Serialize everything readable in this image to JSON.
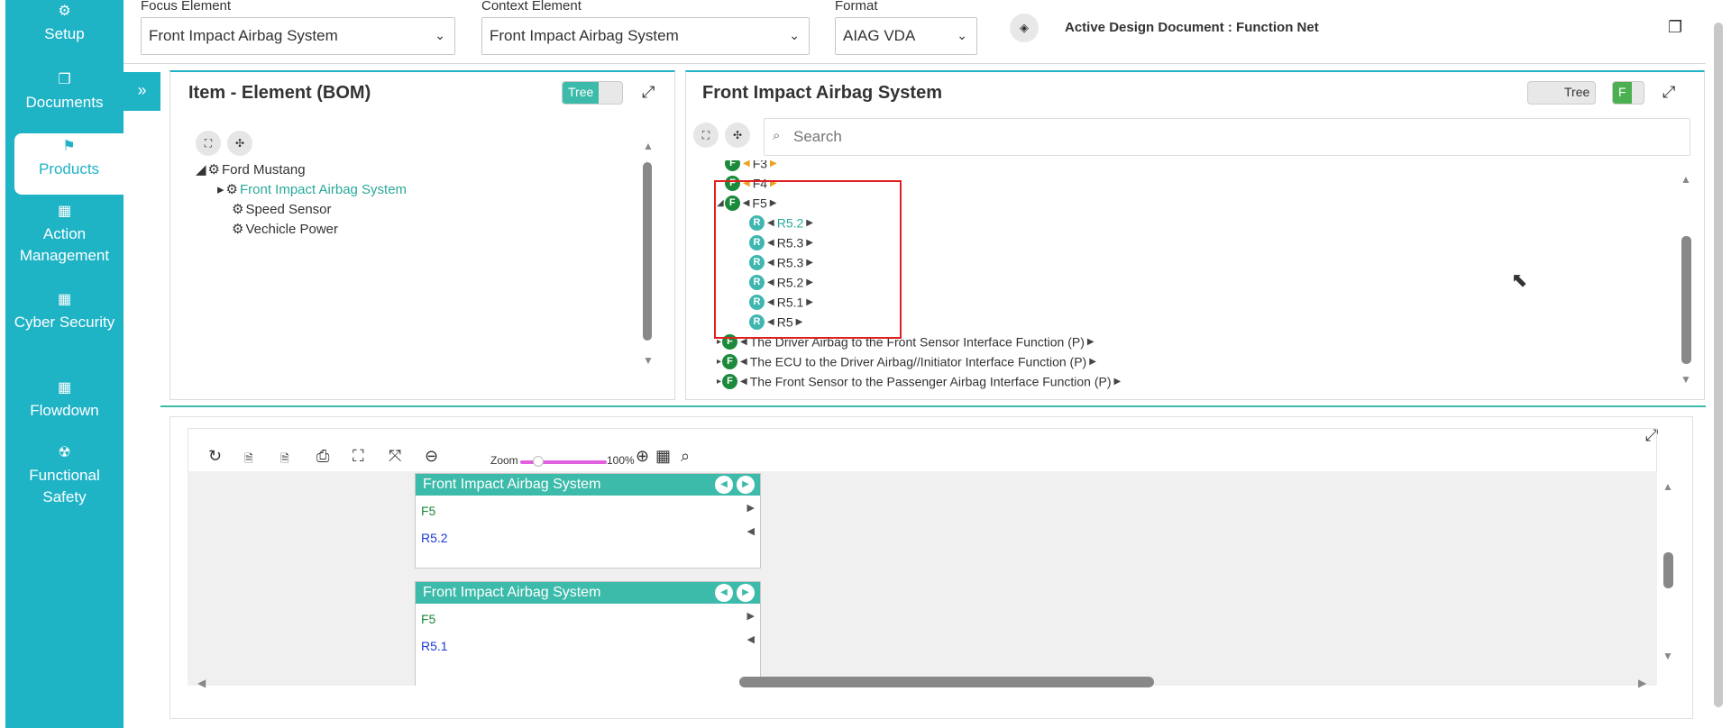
{
  "sidebar": {
    "items": [
      {
        "label": "Setup",
        "icon": "gears-icon"
      },
      {
        "label": "Documents",
        "icon": "documents-icon"
      },
      {
        "label": "Products",
        "icon": "products-icon"
      },
      {
        "label": "Action Management",
        "icon": "building-icon"
      },
      {
        "label": "Cyber Security",
        "icon": "building-icon"
      },
      {
        "label": "Flowdown",
        "icon": "building-icon"
      },
      {
        "label": "Functional Safety",
        "icon": "radiation-icon"
      }
    ]
  },
  "topbar": {
    "focus_label": "Focus Element",
    "focus_value": "Front Impact Airbag System",
    "context_label": "Context Element",
    "context_value": "Front Impact Airbag System",
    "format_label": "Format",
    "format_value": "AIAG VDA",
    "active_doc": "Active Design Document : Function Net"
  },
  "bom_panel": {
    "title": "Item - Element (BOM)",
    "toggle_label": "Tree",
    "tree": [
      {
        "label": "Ford Mustang"
      },
      {
        "label": "Front Impact Airbag System"
      },
      {
        "label": "Speed Sensor"
      },
      {
        "label": "Vechicle Power"
      }
    ]
  },
  "fn_panel": {
    "title": "Front Impact Airbag System",
    "toggle_label": "Tree",
    "toggle_f": "F",
    "search_placeholder": "Search",
    "nodes": [
      {
        "badge": "F",
        "label": "F3"
      },
      {
        "badge": "F",
        "label": "F4"
      },
      {
        "badge": "F",
        "label": "F5"
      },
      {
        "badge": "R",
        "label": "R5.2"
      },
      {
        "badge": "R",
        "label": "R5.3"
      },
      {
        "badge": "R",
        "label": "R5.3"
      },
      {
        "badge": "R",
        "label": "R5.2"
      },
      {
        "badge": "R",
        "label": "R5.1"
      },
      {
        "badge": "R",
        "label": "R5"
      },
      {
        "badge": "F",
        "label": "The Driver Airbag to the Front Sensor Interface Function (P)"
      },
      {
        "badge": "F",
        "label": "The ECU to the Driver Airbag//Initiator Interface Function (P)"
      },
      {
        "badge": "F",
        "label": "The Front Sensor to the Passenger Airbag Interface Function (P)"
      }
    ]
  },
  "diagram": {
    "zoom_label": "Zoom",
    "zoom_value": "100%",
    "zoom_level_percent": 100,
    "cards": [
      {
        "title": "Front Impact Airbag System",
        "f": "F5",
        "r": "R5.2"
      },
      {
        "title": "Front Impact Airbag System",
        "f": "F5",
        "r": "R5.1"
      }
    ]
  },
  "colors": {
    "sidebar": "#1fb3c6",
    "accent": "#3dbbaa",
    "function_badge": "#1b8a3a",
    "requirement_badge": "#3fb6b0",
    "highlight": "#e02020"
  }
}
